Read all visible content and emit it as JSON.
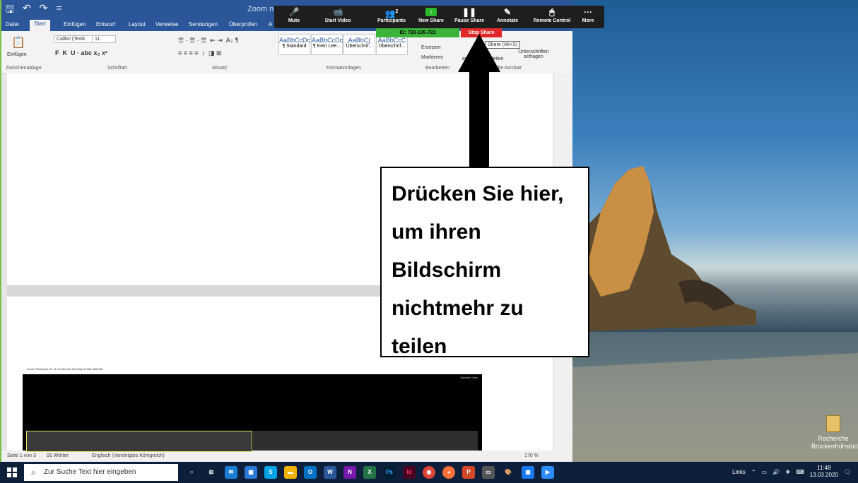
{
  "word": {
    "title": "Zoom nicht",
    "qat": [
      "🖫",
      "↶",
      "↷",
      "="
    ],
    "tabs": [
      "Datei",
      "Start",
      "Einfügen",
      "Entwurf",
      "Layout",
      "Verweise",
      "Sendungen",
      "Überprüfen",
      "A"
    ],
    "ribbon": {
      "paste_label": "Einfügen",
      "font_name": "Calibri (Textk",
      "font_size": "11",
      "groups": [
        "Zwischenablage",
        "Schriftart",
        "Absatz",
        "Formatvorlagen",
        "Bearbeiten",
        "Adobe Acrobat"
      ],
      "styles": [
        {
          "preview": "AaBbCcDc",
          "name": "¶ Standard"
        },
        {
          "preview": "AaBbCcDc",
          "name": "¶ Kein Lee..."
        },
        {
          "preview": "AaBbC(",
          "name": "Überschrif..."
        },
        {
          "preview": "AaBbCcC",
          "name": "Überschrif..."
        }
      ],
      "edit_replace": "Ersetzen",
      "edit_select": "Markieren",
      "acrobat_share": "Share (Alt+S)",
      "acrobat_create": "erst",
      "acrobat_share_label": "d teilen",
      "acrobat_sign": "Unterschriften anfragen"
    },
    "status": {
      "page": "Seite 1 von 3",
      "words": "91 Wörter",
      "lang": "Englisch (Vereinigtes Königreich)",
      "zoom": "170 %"
    }
  },
  "zoom_window": {
    "title": "Zoom Participant ID: 21   40-Minutes Meeting ID:382-984-096",
    "speaker_view": "Speaker View"
  },
  "zoom_toolbar": {
    "buttons": [
      {
        "label": "Mute",
        "icon": "🎤"
      },
      {
        "label": "Start Video",
        "icon": "📹"
      },
      {
        "label": "Participants",
        "icon": "👥"
      },
      {
        "label": "New Share",
        "icon": "↑"
      },
      {
        "label": "Pause Share",
        "icon": "❚❚"
      },
      {
        "label": "Annotate",
        "icon": "✎"
      },
      {
        "label": "Remote Control",
        "icon": "🖱"
      },
      {
        "label": "More",
        "icon": "···"
      }
    ],
    "participants_count": "2",
    "meeting_id": "ID: 728-135-723",
    "stop_share": "Stop Share"
  },
  "callout": {
    "lines": [
      "Drücken Sie hier,",
      "um ihren",
      "Bildschirm",
      "nichtmehr zu",
      "teilen"
    ]
  },
  "desktop": {
    "icon_label": "Recherche Brückenfrühstück"
  },
  "taskbar": {
    "search_placeholder": "Zur Suche Text hier eingeben",
    "tray_label": "Links",
    "time": "11:48",
    "date": "13.03.2020"
  }
}
